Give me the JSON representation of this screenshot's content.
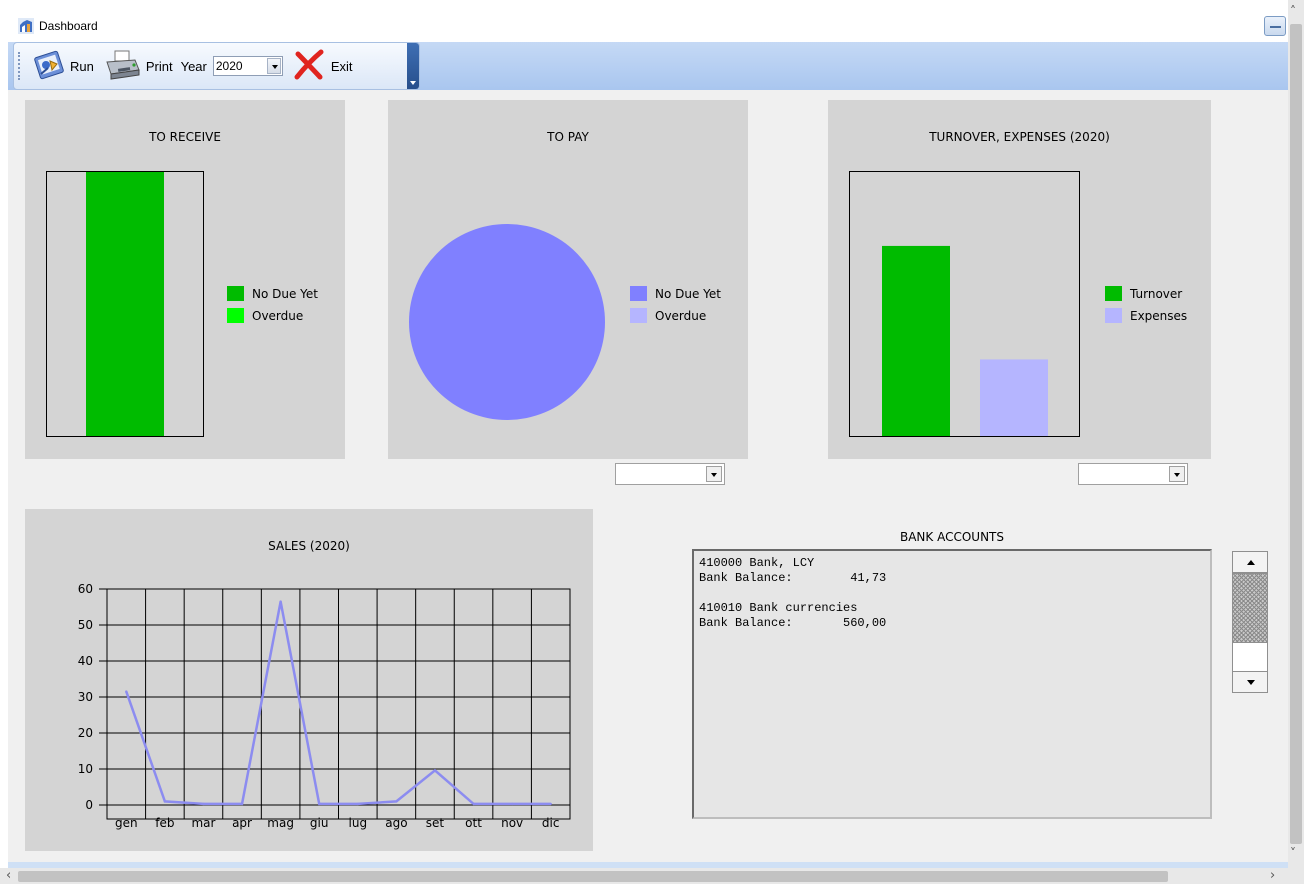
{
  "window": {
    "title": "Dashboard"
  },
  "toolbar": {
    "run_label": "Run",
    "print_label": "Print",
    "year_label": "Year",
    "year_value": "2020",
    "exit_label": "Exit"
  },
  "colors": {
    "receive_no_due": "#00bb00",
    "receive_overdue": "#00ff00",
    "pay_no_due": "#8080ff",
    "pay_overdue": "#b5b5ff",
    "turnover": "#00bb00",
    "expenses": "#b5b5ff",
    "sales_line": "#8c8cf0",
    "panel_bg": "#d4d4d4"
  },
  "panels": {
    "to_receive": {
      "title": "TO RECEIVE",
      "legend": [
        "No Due Yet",
        "Overdue"
      ]
    },
    "to_pay": {
      "title": "TO PAY",
      "legend": [
        "No Due Yet",
        "Overdue"
      ],
      "combo_value": ""
    },
    "turnover": {
      "title": "TURNOVER, EXPENSES (2020)",
      "legend": [
        "Turnover",
        "Expenses"
      ],
      "combo_value": ""
    },
    "sales": {
      "title": "SALES (2020)"
    },
    "bank": {
      "title": "BANK ACCOUNTS",
      "text": "410000 Bank, LCY\nBank Balance:        41,73\n\n410010 Bank currencies\nBank Balance:       560,00"
    }
  },
  "chart_data": [
    {
      "type": "bar",
      "title": "TO RECEIVE",
      "series": [
        {
          "name": "No Due Yet",
          "values": [
            1.0
          ]
        },
        {
          "name": "Overdue",
          "values": [
            0.0
          ]
        }
      ],
      "ylim": [
        0,
        1
      ]
    },
    {
      "type": "pie",
      "title": "TO PAY",
      "labels": [
        "No Due Yet",
        "Overdue"
      ],
      "values": [
        100,
        0
      ]
    },
    {
      "type": "bar",
      "title": "TURNOVER, EXPENSES (2020)",
      "categories": [
        "Turnover",
        "Expenses"
      ],
      "values": [
        72,
        29
      ],
      "ylim": [
        0,
        100
      ]
    },
    {
      "type": "line",
      "title": "SALES (2020)",
      "categories": [
        "gen",
        "feb",
        "mar",
        "apr",
        "mag",
        "giu",
        "lug",
        "ago",
        "set",
        "ott",
        "nov",
        "dic"
      ],
      "values": [
        31.5,
        1,
        0.3,
        0.3,
        56.5,
        0.3,
        0.3,
        1,
        9.6,
        0.3,
        0.3,
        0.3
      ],
      "yticks": [
        "0",
        "10",
        "20",
        "30",
        "40",
        "50",
        "60"
      ],
      "ylim": [
        0,
        60
      ],
      "grid": true
    }
  ]
}
